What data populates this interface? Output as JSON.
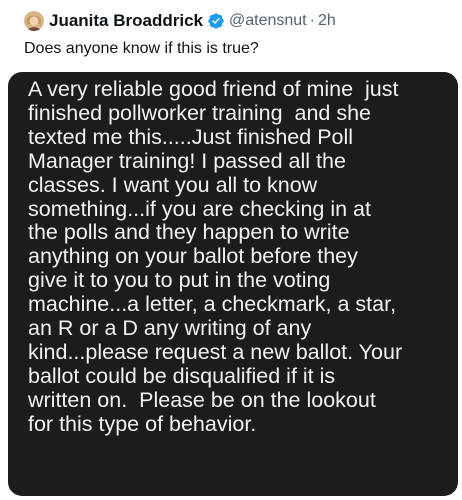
{
  "tweet": {
    "author": {
      "display_name": "Juanita Broaddrick",
      "handle": "@atensnut",
      "verified": true,
      "avatar_icon": "avatar-photo"
    },
    "separator": "·",
    "time": "2h",
    "text": "Does anyone know if this is true?",
    "media": {
      "background": "#1c1c1e",
      "message_lines": [
        "A very reliable good friend of mine  just",
        "finished pollworker training  and she",
        "texted me this.....Just finished Poll",
        "Manager training! I passed all the",
        "classes. I want you all to know",
        "something...if you are checking in at",
        "the polls and they happen to write",
        "anything on your ballot before they",
        "give it to you to put in the voting",
        "machine...a letter, a checkmark, a star,",
        "an R or a D any writing of any",
        "kind...please request a new ballot. Your",
        "ballot could be disqualified if it is",
        "written on.  Please be on the lookout",
        "for this type of behavior."
      ]
    }
  },
  "colors": {
    "verified_badge": "#1d9bf0",
    "secondary_text": "#536471",
    "message_text": "#f2f2f2"
  }
}
